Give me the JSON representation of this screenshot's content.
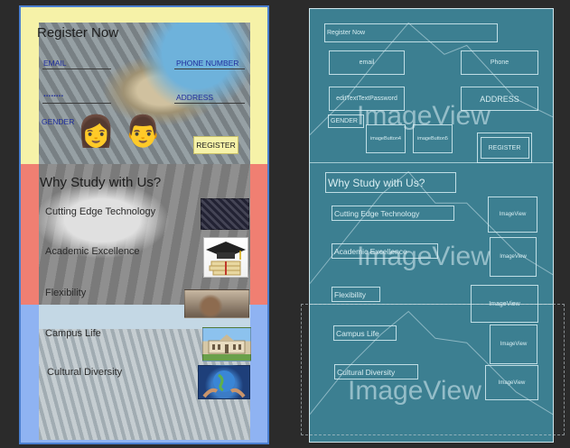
{
  "design": {
    "register_section": {
      "title": "Register Now",
      "email_hint": "EMAIL",
      "phone_hint": "PHONE NUMBER",
      "password_value": "........",
      "address_hint": "ADDRESS",
      "gender_label": "GENDER",
      "female_emoji": "👩",
      "male_emoji": "👨",
      "register_button": "REGISTER"
    },
    "why_section": {
      "title": "Why Study with Us?",
      "items": [
        {
          "label": "Cutting Edge Technology",
          "thumb_icon": "circuit-image"
        },
        {
          "label": "Academic Excellence",
          "thumb_icon": "graduation-cap-image"
        },
        {
          "label": "Flexibility",
          "thumb_icon": "classroom-image"
        },
        {
          "label": "Campus Life",
          "thumb_icon": "campus-building-image"
        },
        {
          "label": "Cultural Diversity",
          "thumb_icon": "globe-hands-image"
        }
      ]
    },
    "colors": {
      "band_yellow": "#f6f2a8",
      "band_red": "#f07f72",
      "band_blue": "#8fb3f2",
      "hint_blue": "#1f2e9e"
    }
  },
  "blueprint": {
    "register_now": "Register Now",
    "email": "email",
    "phone": "Phone",
    "password": "editTextTextPassword",
    "address": "ADDRESS",
    "gender": "GENDER",
    "image_button_1": "imageButton4",
    "image_button_2": "imageButton5",
    "register": "REGISTER",
    "imageview_big": "ImageView",
    "why": "Why Study with Us?",
    "items": [
      "Cutting Edge Technology",
      "Academic Excellence",
      "Flexibility",
      "Campus Life",
      "Cultural Diversity"
    ],
    "imageview_small": "ImageView"
  }
}
